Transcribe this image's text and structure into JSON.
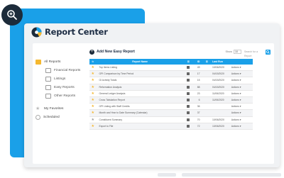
{
  "app": {
    "title": "Report Center"
  },
  "colors": {
    "accent": "#1aa0e8",
    "dark": "#1c2b3a",
    "star": "#f5b830"
  },
  "zoom": {
    "icon": "zoom-in-icon"
  },
  "sidebar": {
    "items": [
      {
        "label": "All Reports",
        "icon": "folder-icon",
        "level": 0
      },
      {
        "label": "Financial Reports",
        "icon": "folder-outline-icon",
        "level": 1
      },
      {
        "label": "Listings",
        "icon": "folder-outline-icon",
        "level": 1
      },
      {
        "label": "Easy Reports",
        "icon": "folder-outline-icon",
        "level": 1
      },
      {
        "label": "Other Reports",
        "icon": "folder-outline-icon",
        "level": 1
      }
    ],
    "favorites": "My Favorites",
    "scheduled": "Scheduled"
  },
  "toolbar": {
    "add_label": "Add New Easy Report",
    "show_label": "Show",
    "show_value": "10",
    "search_placeholder": "Search for a Report"
  },
  "table": {
    "headers": {
      "star": "",
      "name": "Report Name",
      "type": "☰",
      "id": "ID",
      "num": "☰",
      "date": "Last Run",
      "action": ""
    },
    "rows": [
      {
        "star": "yellow",
        "name": "Top Items Listing",
        "id": "49",
        "date": "10/06/2020",
        "action": "Actions"
      },
      {
        "star": "yellow",
        "name": "GPI Comparison by Time Period",
        "id": "17",
        "date": "04/15/2020",
        "action": "Actions"
      },
      {
        "star": "yellow",
        "name": "GI Activity Totals",
        "id": "15",
        "date": "04/15/2020",
        "action": "Actions"
      },
      {
        "star": "yellow",
        "name": "Reformation Analysis",
        "id": "88",
        "date": "04/15/2020",
        "action": "Actions"
      },
      {
        "star": "yellow",
        "name": "General Ledger Analysis",
        "id": "23",
        "date": "11/06/2020",
        "action": "Actions"
      },
      {
        "star": "yellow",
        "name": "Cross Tabulation Report",
        "id": "6",
        "date": "11/06/2020",
        "action": "Actions"
      },
      {
        "star": "yellow",
        "name": "GPI Listing with Staff Credits",
        "id": "36",
        "date": "",
        "action": "Actions"
      },
      {
        "star": "yellow",
        "name": "Month and Year to Date Summary (Calendar)",
        "id": "37",
        "date": "",
        "action": "Actions"
      },
      {
        "star": "gray",
        "name": "Constituent Summary",
        "id": "70",
        "date": "10/06/2020",
        "action": "Actions"
      },
      {
        "star": "yellow",
        "name": "Export to File",
        "id": "72",
        "date": "10/06/2020",
        "action": "Actions"
      }
    ]
  }
}
